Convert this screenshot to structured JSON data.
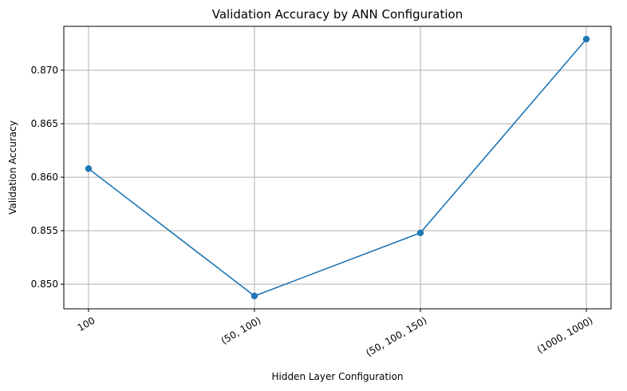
{
  "chart_data": {
    "type": "line",
    "title": "Validation Accuracy by ANN Configuration",
    "xlabel": "Hidden Layer Configuration",
    "ylabel": "Validation Accuracy",
    "categories": [
      "100",
      "(50, 100)",
      "(50, 100, 150)",
      "(1000, 1000)"
    ],
    "series": [
      {
        "values": [
          0.8608,
          0.8489,
          0.8548,
          0.8729
        ],
        "color": "#1f77b4",
        "marker": "circle"
      }
    ],
    "ylim": [
      0.8477,
      0.8741
    ],
    "yticks": [
      0.85,
      0.855,
      0.86,
      0.865,
      0.87
    ],
    "ytick_labels": [
      "0.850",
      "0.855",
      "0.860",
      "0.865",
      "0.870"
    ],
    "xtick_rotation": 30,
    "grid": true,
    "legend": "none"
  }
}
